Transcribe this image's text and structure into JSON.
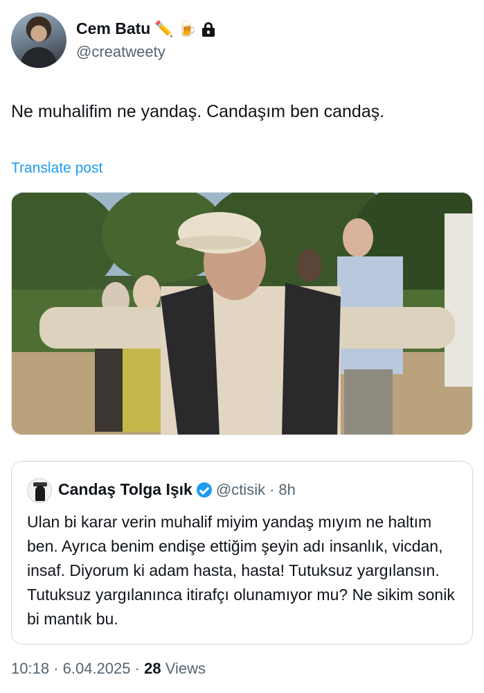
{
  "author": {
    "name": "Cem Batu",
    "emojis": [
      "✏️",
      "🍺"
    ],
    "handle": "@creatweety",
    "lock_icon": "lock-icon"
  },
  "tweet": {
    "text": "Ne muhalifim ne yandaş. Candaşım ben candaş.",
    "translate_label": "Translate post"
  },
  "quote": {
    "author_name": "Candaş Tolga Işık",
    "handle": "@ctisik",
    "separator": "·",
    "time": "8h",
    "verified_icon": "verified-badge-icon",
    "text": "Ulan bi karar verin muhalif miyim yandaş mıyım ne haltım ben. Ayrıca benim endişe ettiğim şeyin adı insanlık, vicdan, insaf. Diyorum ki adam hasta, hasta! Tutuksuz yargılansın. Tutuksuz yargılanınca itirafçı olunamıyor mu? Ne sikim sonik bi mantık bu."
  },
  "footer": {
    "time": "10:18",
    "sep1": "·",
    "date": "6.04.2025",
    "sep2": "·",
    "views_count": "28",
    "views_label": "Views"
  },
  "colors": {
    "text": "#0f1419",
    "secondary": "#536471",
    "link": "#1d9bf0",
    "border": "#cfd9de"
  }
}
